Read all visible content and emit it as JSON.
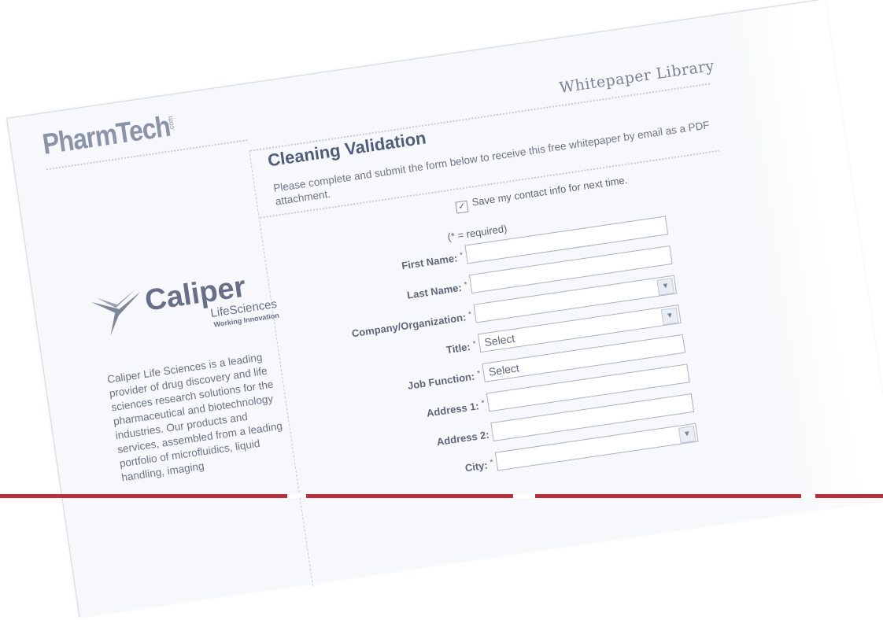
{
  "header": {
    "library_title": "Whitepaper Library",
    "logo_text": "PharmTech",
    "logo_suffix": ".com"
  },
  "sponsor": {
    "name": "Caliper",
    "sub": "LifeSciences",
    "tagline": "Working Innovation",
    "description": "Caliper Life Sciences is a leading provider of drug discovery and life sciences research solutions for the pharmaceutical and biotechnology industries. Our products and services, assembled from a leading portfolio of microfluidics, liquid handling, imaging"
  },
  "form": {
    "title": "Cleaning Validation",
    "intro": "Please complete and submit the form below to receive this free whitepaper by email as a PDF attachment.",
    "save_label": "Save my contact info for next time.",
    "save_checked": true,
    "required_note": "(* = required)",
    "fields": {
      "first_name": {
        "label": "First Name:",
        "required": "*",
        "value": ""
      },
      "last_name": {
        "label": "Last Name:",
        "required": "*",
        "value": ""
      },
      "company": {
        "label": "Company/Organization:",
        "required": "*",
        "value": ""
      },
      "title": {
        "label": "Title:",
        "required": "*",
        "value": "Select"
      },
      "job_function": {
        "label": "Job Function:",
        "required": "*",
        "value": "Select"
      },
      "address1": {
        "label": "Address 1:",
        "required": "*",
        "value": ""
      },
      "address2": {
        "label": "Address 2:",
        "required": "",
        "value": ""
      },
      "city": {
        "label": "City:",
        "required": "*",
        "value": ""
      }
    }
  },
  "colors": {
    "accent": "#4f5d7a",
    "bar": "#b8303a"
  },
  "icons": {
    "dropdown": "chevron-down-icon",
    "checkbox": "checkmark-icon"
  }
}
